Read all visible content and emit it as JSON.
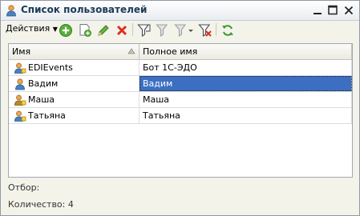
{
  "window": {
    "title": "Список пользователей"
  },
  "toolbar": {
    "actions_label": "Действия"
  },
  "table": {
    "columns": [
      "Имя",
      "Полное имя"
    ],
    "rows": [
      {
        "name": "EDIEvents",
        "full": "Бот 1С-ЭДО"
      },
      {
        "name": "Вадим",
        "full": "Вадим"
      },
      {
        "name": "Маша",
        "full": "Маша"
      },
      {
        "name": "Татьяна",
        "full": "Татьяна"
      }
    ]
  },
  "footer": {
    "filter_label": "Отбор:",
    "count_label": "Количество: 4"
  },
  "colors": {
    "selection": "#3c6fc2",
    "title": "#1c3a57"
  },
  "icons": [
    "user-icon",
    "add-icon",
    "copy-icon",
    "edit-icon",
    "delete-icon",
    "filter-icon",
    "filter-list-icon",
    "filter-history-icon",
    "clear-filter-icon",
    "refresh-icon",
    "minimize-icon",
    "maximize-icon",
    "close-icon",
    "sort-icon"
  ]
}
